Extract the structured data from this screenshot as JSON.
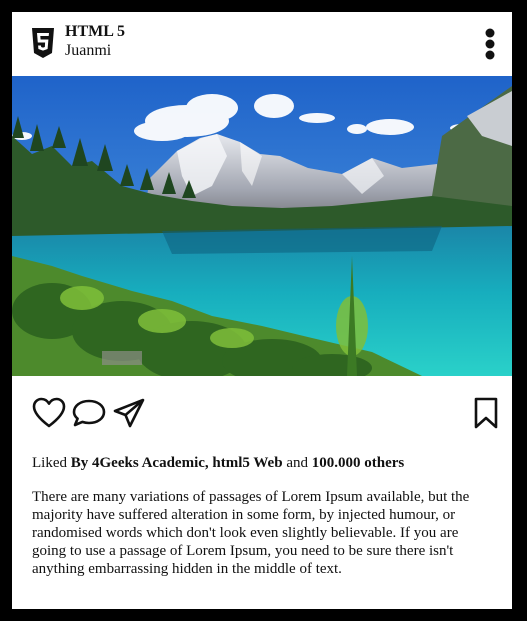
{
  "post": {
    "account_title": "HTML 5",
    "account_user": "Juanmi",
    "logo_icon": "html5-logo-icon",
    "menu_icon": "more-vertical-icon"
  },
  "image": {
    "description_icon": "mountain-lake-photo"
  },
  "actions": {
    "like_icon": "heart-icon",
    "comment_icon": "comment-icon",
    "share_icon": "send-icon",
    "save_icon": "bookmark-icon"
  },
  "likes": {
    "prefix": "Liked ",
    "by": "By 4Geeks Academic, html5 Web",
    "and": " and ",
    "others": "100.000 others"
  },
  "caption": "There are many variations of passages of Lorem Ipsum available, but the majority have suffered alteration in some form, by injected humour, or randomised words which don't look even slightly believable. If you are going to use a passage of Lorem Ipsum, you need to be sure there isn't anything embarrassing hidden in the middle of text."
}
